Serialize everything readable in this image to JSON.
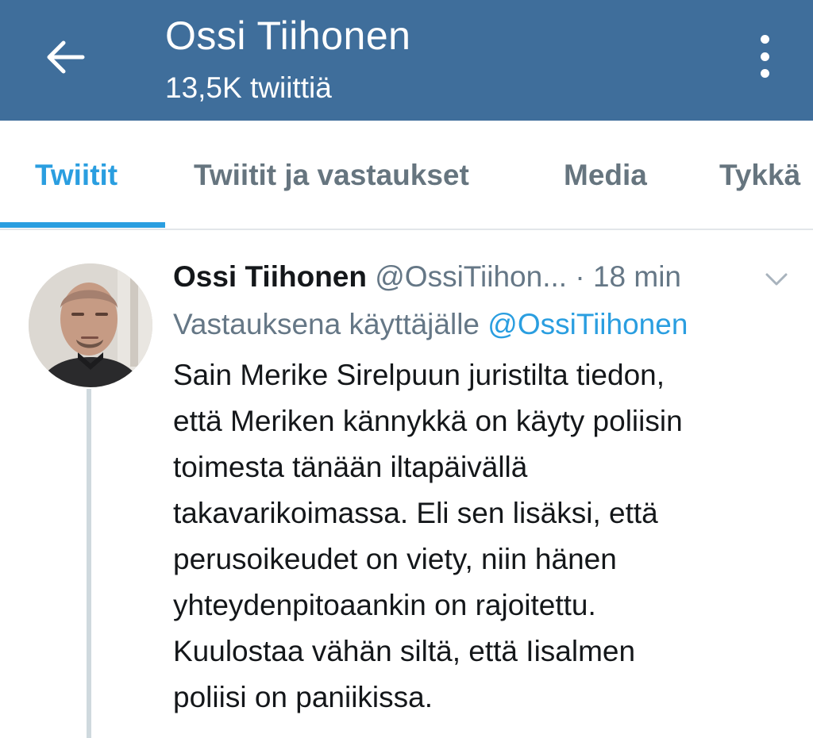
{
  "header": {
    "title": "Ossi Tiihonen",
    "subtitle": "13,5K twiittiä",
    "back_icon": "arrow-left-icon",
    "more_icon": "more-vertical-icon"
  },
  "tabs": [
    {
      "label": "Twiitit",
      "active": true
    },
    {
      "label": "Twiitit ja vastaukset",
      "active": false
    },
    {
      "label": "Media",
      "active": false
    },
    {
      "label": "Tykkä",
      "active": false
    }
  ],
  "tweet": {
    "author_name": "Ossi Tiihonen",
    "handle": "@OssiTiihon...",
    "separator": "·",
    "time": "18 min",
    "reply_prefix": "Vastauksena käyttäjälle",
    "reply_to": "@OssiTiihonen",
    "text_lines": [
      "Sain Merike Sirelpuun juristilta tiedon,",
      "että Meriken kännykkä on käyty poliisin",
      "toimesta tänään iltapäivällä",
      "takavarikoimassa. Eli sen lisäksi, että",
      "perusoikeudet on viety, niin hänen",
      "yhteydenpitoaankin on rajoitettu.",
      "Kuulostaa vähän siltä, että Iisalmen",
      "poliisi on paniikissa."
    ]
  },
  "colors": {
    "header_bg": "#3f6e9b",
    "accent": "#2a9ee0",
    "muted": "#657786"
  }
}
